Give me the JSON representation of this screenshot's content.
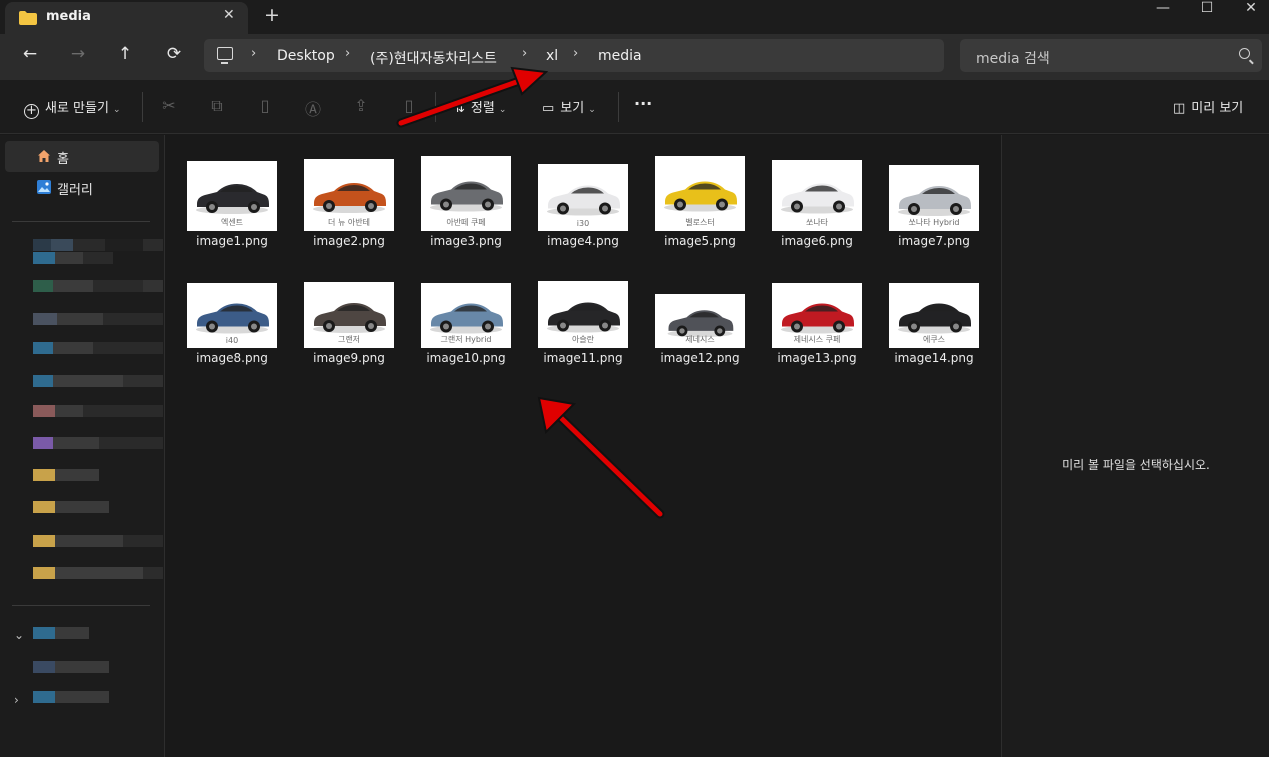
{
  "window": {
    "tab_title": "media",
    "close_tab": "✕",
    "new_tab": "+"
  },
  "window_controls": {
    "minimize": "—",
    "maximize": "☐",
    "close": "✕"
  },
  "nav": {
    "back": "←",
    "forward": "→",
    "up": "↑",
    "refresh": "⟳"
  },
  "breadcrumb": [
    "Desktop",
    "(주)현대자동차리스트",
    "xl",
    "media"
  ],
  "search": {
    "placeholder": "media 검색"
  },
  "toolbar": {
    "new_label": "새로 만들기",
    "sort_label": "정렬",
    "view_label": "보기",
    "more": "···",
    "preview_label": "미리 보기"
  },
  "sidebar": {
    "items": [
      {
        "label": "홈",
        "icon": "home-icon",
        "selected": true
      },
      {
        "label": "갤러리",
        "icon": "gallery-icon",
        "selected": false
      }
    ]
  },
  "files": [
    {
      "name": "image1.png",
      "caption": "엑센트",
      "car_color": "#2a2a2e"
    },
    {
      "name": "image2.png",
      "caption": "더 뉴 아반테",
      "car_color": "#c4521c"
    },
    {
      "name": "image3.png",
      "caption": "아반떼 쿠페",
      "car_color": "#6a6c70"
    },
    {
      "name": "image4.png",
      "caption": "i30",
      "car_color": "#e8e8ea"
    },
    {
      "name": "image5.png",
      "caption": "벨로스터",
      "car_color": "#e8c01a"
    },
    {
      "name": "image6.png",
      "caption": "쏘나타",
      "car_color": "#ececee"
    },
    {
      "name": "image7.png",
      "caption": "쏘나타 Hybrid",
      "car_color": "#b8bcc2"
    },
    {
      "name": "image8.png",
      "caption": "i40",
      "car_color": "#3c5c88"
    },
    {
      "name": "image9.png",
      "caption": "그랜저",
      "car_color": "#4e4642"
    },
    {
      "name": "image10.png",
      "caption": "그랜저 Hybrid",
      "car_color": "#6888a8"
    },
    {
      "name": "image11.png",
      "caption": "아슬란",
      "car_color": "#262628"
    },
    {
      "name": "image12.png",
      "caption": "제네시스",
      "car_color": "#505258"
    },
    {
      "name": "image13.png",
      "caption": "제네시스 쿠페",
      "car_color": "#c01a22"
    },
    {
      "name": "image14.png",
      "caption": "에쿠스",
      "car_color": "#222224"
    }
  ],
  "preview_pane": {
    "message": "미리 볼 파일을 선택하십시오."
  },
  "colors": {
    "annotation_arrow": "#e00000"
  }
}
